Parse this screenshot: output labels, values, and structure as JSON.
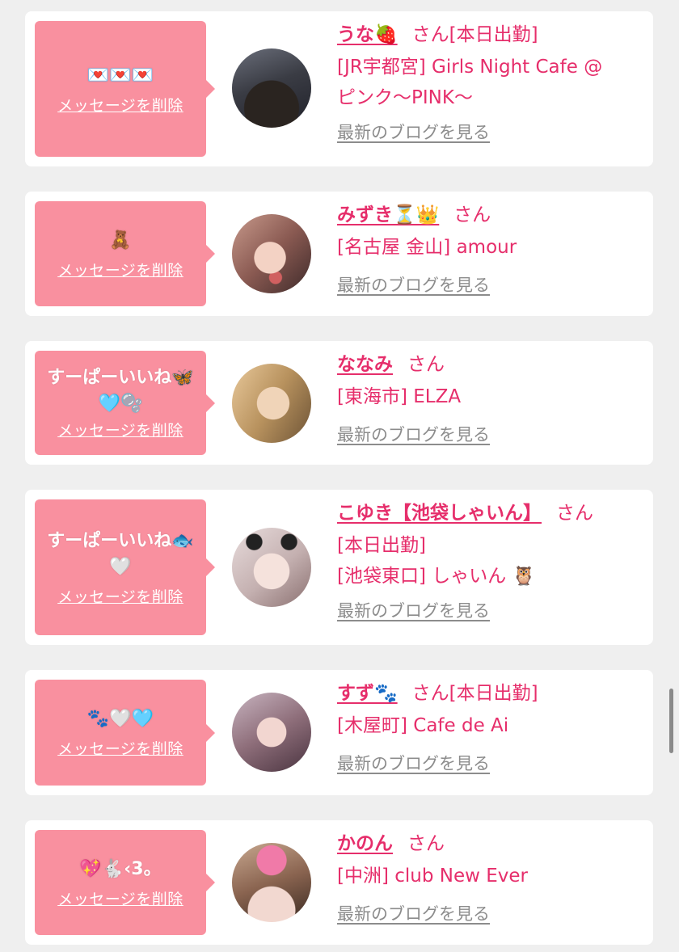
{
  "messages": [
    {
      "bubble_text": "💌💌💌",
      "delete_label": "メッセージを削除",
      "name": "うな🍓",
      "honorific": "さん",
      "status": "[本日出勤]",
      "shop_lines": [
        "[JR宇都宮] Girls Night Cafe @",
        "ピンク〜PINK〜"
      ],
      "blog_label": "最新のブログを見る"
    },
    {
      "bubble_text": "🧸",
      "delete_label": "メッセージを削除",
      "name": "みずき⏳👑",
      "honorific": "さん",
      "status": "",
      "shop_lines": [
        "[名古屋 金山] amour"
      ],
      "blog_label": "最新のブログを見る"
    },
    {
      "bubble_text": "すーぱーいいね🦋🩵🫧",
      "delete_label": "メッセージを削除",
      "name": "ななみ",
      "honorific": "さん",
      "status": "",
      "shop_lines": [
        "[東海市] ELZA"
      ],
      "blog_label": "最新のブログを見る"
    },
    {
      "bubble_text": "すーぱーいいね🐟🤍",
      "delete_label": "メッセージを削除",
      "name": "こゆき【池袋しゃいん】",
      "honorific": "さん",
      "status": "",
      "shop_lines": [
        "[本日出勤]",
        "[池袋東口] しゃいん 🦉"
      ],
      "blog_label": "最新のブログを見る"
    },
    {
      "bubble_text": "🐾🤍🩵",
      "delete_label": "メッセージを削除",
      "name": "すず🐾",
      "honorific": "さん",
      "status": "[本日出勤]",
      "shop_lines": [
        "[木屋町] Cafe de Ai"
      ],
      "blog_label": "最新のブログを見る"
    },
    {
      "bubble_text": "💖🐇‹3。",
      "delete_label": "メッセージを削除",
      "name": "かのん",
      "honorific": "さん",
      "status": "",
      "shop_lines": [
        "[中洲] club New Ever"
      ],
      "blog_label": "最新のブログを見る"
    }
  ],
  "colors": {
    "accent": "#e62e6b",
    "bubble": "#f9909f",
    "background": "#efefef",
    "link_gray": "#8c8c8c"
  }
}
